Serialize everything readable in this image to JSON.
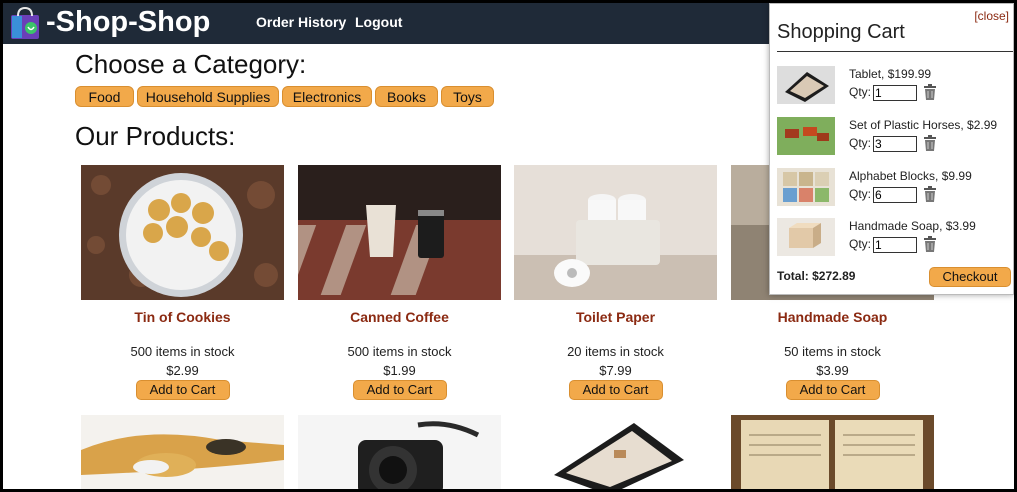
{
  "nav": {
    "brand": "-Shop-Shop",
    "links": [
      "Order History",
      "Logout"
    ]
  },
  "categories": {
    "heading": "Choose a Category:",
    "items": [
      "Food",
      "Household Supplies",
      "Electronics",
      "Books",
      "Toys"
    ]
  },
  "products": {
    "heading": "Our Products:",
    "add_label": "Add to Cart",
    "items": [
      {
        "name": "Tin of Cookies",
        "stock": "500 items in stock",
        "price": "$2.99"
      },
      {
        "name": "Canned Coffee",
        "stock": "500 items in stock",
        "price": "$1.99"
      },
      {
        "name": "Toilet Paper",
        "stock": "20 items in stock",
        "price": "$7.99"
      },
      {
        "name": "Handmade Soap",
        "stock": "50 items in stock",
        "price": "$3.99"
      }
    ]
  },
  "cart": {
    "close_label": "[close]",
    "title": "Shopping Cart",
    "qty_label": "Qty:",
    "items": [
      {
        "name": "Tablet, $199.99",
        "qty": "1"
      },
      {
        "name": "Set of Plastic Horses, $2.99",
        "qty": "3"
      },
      {
        "name": "Alphabet Blocks, $9.99",
        "qty": "6"
      },
      {
        "name": "Handmade Soap, $3.99",
        "qty": "1"
      }
    ],
    "total": "Total: $272.89",
    "checkout_label": "Checkout"
  },
  "colors": {
    "navbar": "#1f2a38",
    "accent": "#f2a94a",
    "product_name": "#8b2a12"
  }
}
